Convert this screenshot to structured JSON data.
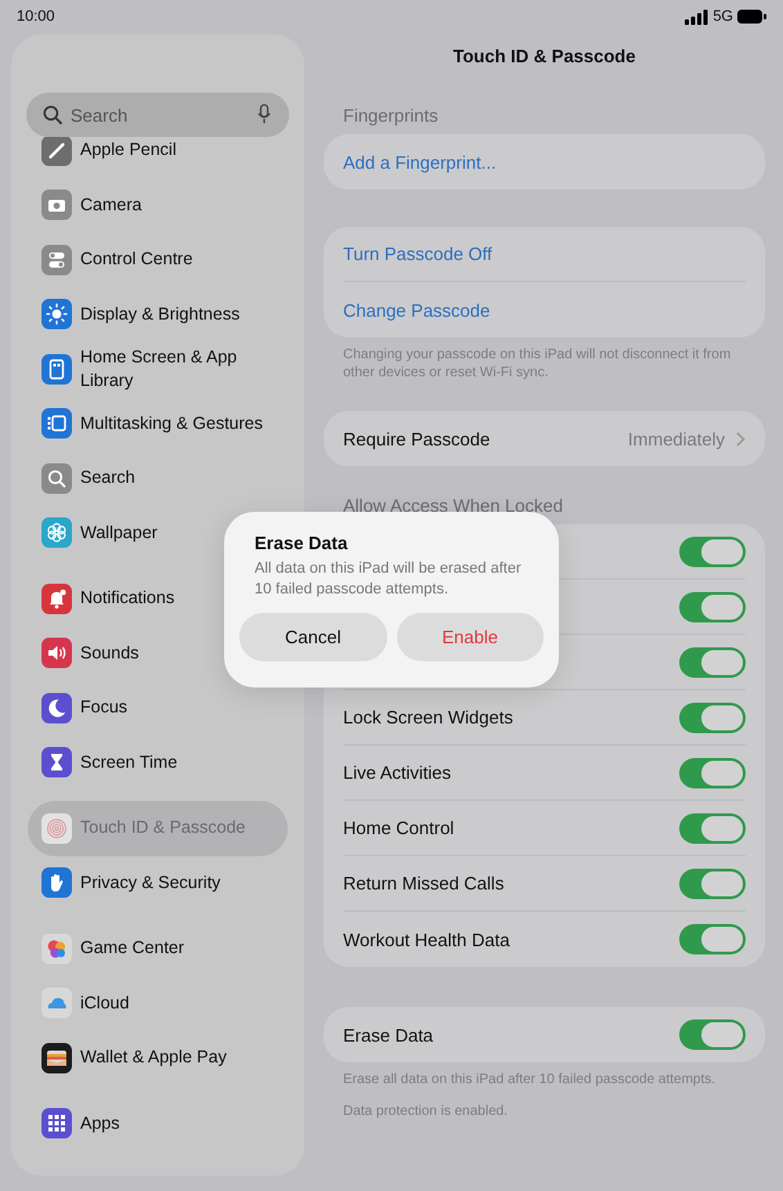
{
  "status_bar": {
    "time": "10:00",
    "network": "5G"
  },
  "sidebar": {
    "search": {
      "placeholder": "Search"
    },
    "groups": [
      {
        "items": [
          {
            "label": "Apple Pencil",
            "color": "#6d6d70",
            "selected": false
          },
          {
            "label": "Camera",
            "color": "#8a8a8d",
            "selected": false
          },
          {
            "label": "Control Centre",
            "color": "#8a8a8d",
            "selected": false
          },
          {
            "label": "Display & Brightness",
            "color": "#1f74d4",
            "selected": false
          },
          {
            "label": "Home Screen & App Library",
            "color": "#1f74d4",
            "selected": false
          },
          {
            "label": "Multitasking & Gestures",
            "color": "#1f74d4",
            "selected": false
          },
          {
            "label": "Search",
            "color": "#8a8a8d",
            "selected": false
          },
          {
            "label": "Wallpaper",
            "color": "#2aa7c9",
            "selected": false
          }
        ]
      },
      {
        "items": [
          {
            "label": "Notifications",
            "color": "#d6363b",
            "selected": false
          },
          {
            "label": "Sounds",
            "color": "#d6354e",
            "selected": false
          },
          {
            "label": "Focus",
            "color": "#5b4fcf",
            "selected": false
          },
          {
            "label": "Screen Time",
            "color": "#5b4fcf",
            "selected": false
          }
        ]
      },
      {
        "items": [
          {
            "label": "Touch ID & Passcode",
            "color": "#e2e2e2",
            "selected": true
          },
          {
            "label": "Privacy & Security",
            "color": "#1f74d4",
            "selected": false
          }
        ]
      },
      {
        "items": [
          {
            "label": "Game Center",
            "color": "#d8d8d8",
            "selected": false
          },
          {
            "label": "iCloud",
            "color": "#d8d8d8",
            "selected": false
          },
          {
            "label": "Wallet & Apple Pay",
            "color": "#1c1c1e",
            "selected": false
          }
        ]
      },
      {
        "items": [
          {
            "label": "Apps",
            "color": "#5b4fcf",
            "selected": false
          }
        ]
      }
    ]
  },
  "detail": {
    "title": "Touch ID & Passcode",
    "sections": [
      {
        "header": "Fingerprints",
        "rows": [
          {
            "kind": "link",
            "label": "Add a Fingerprint..."
          }
        ]
      },
      {
        "rows": [
          {
            "kind": "link",
            "label": "Turn Passcode Off"
          },
          {
            "kind": "link",
            "label": "Change Passcode"
          }
        ],
        "footers": [
          "Changing your passcode on this iPad will not disconnect it from other devices or reset Wi-Fi sync."
        ]
      },
      {
        "rows": [
          {
            "kind": "value",
            "label": "Require Passcode",
            "value": "Immediately"
          }
        ]
      },
      {
        "header": "Allow Access When Locked",
        "rows": [
          {
            "kind": "toggle",
            "on": true
          },
          {
            "kind": "toggle",
            "on": true
          },
          {
            "kind": "toggle",
            "on": true
          },
          {
            "kind": "toggle",
            "label": "Lock Screen Widgets",
            "on": true
          },
          {
            "kind": "toggle",
            "label": "Live Activities",
            "on": true
          },
          {
            "kind": "toggle",
            "label": "Home Control",
            "on": true
          },
          {
            "kind": "toggle",
            "label": "Return Missed Calls",
            "on": true
          },
          {
            "kind": "toggle",
            "label": "Workout Health Data",
            "on": true
          }
        ]
      },
      {
        "rows": [
          {
            "kind": "toggle",
            "label": "Erase Data",
            "on": true
          }
        ],
        "footers": [
          "Erase all data on this iPad after 10 failed passcode attempts.",
          "Data protection is enabled."
        ]
      }
    ]
  },
  "alert": {
    "title": "Erase Data",
    "message": "All data on this iPad will be erased after 10 failed passcode attempts.",
    "buttons": [
      {
        "label": "Cancel",
        "kind": "default"
      },
      {
        "label": "Enable",
        "kind": "destructive"
      }
    ]
  }
}
